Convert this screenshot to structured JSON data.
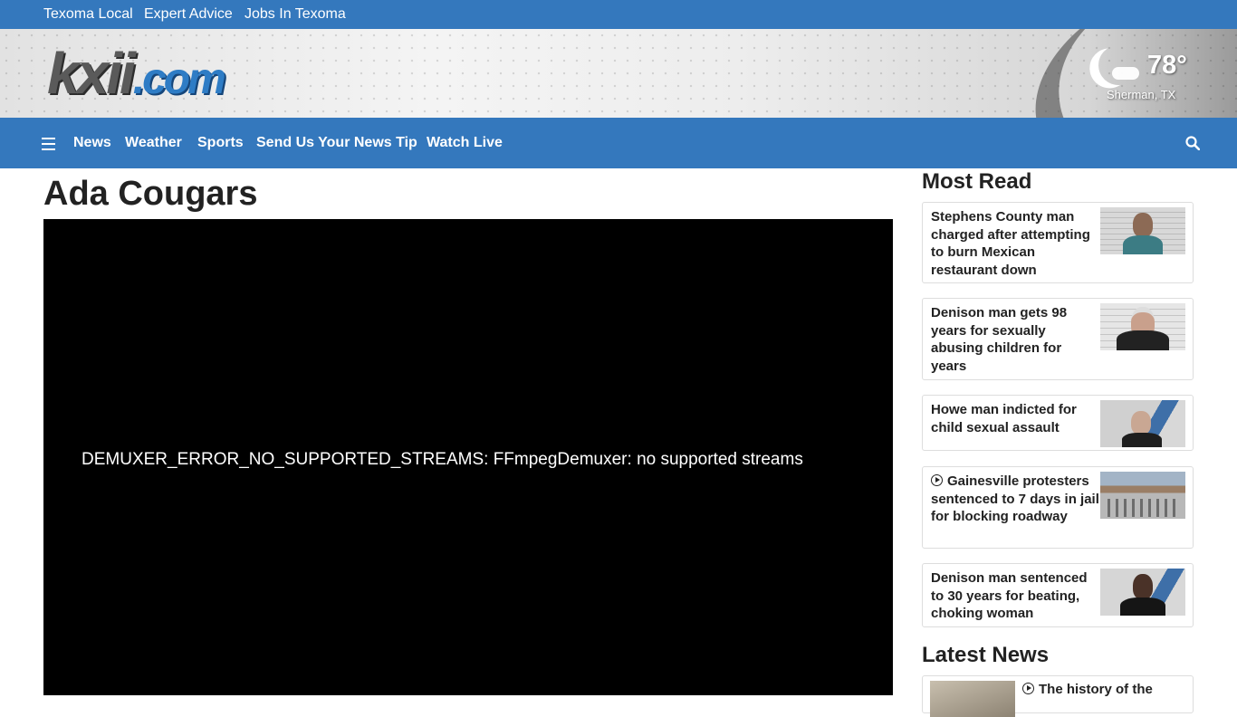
{
  "topbar": {
    "links": [
      "Texoma Local",
      "Expert Advice",
      "Jobs In Texoma"
    ]
  },
  "logo": {
    "part1": "kxii",
    "part2": ".com"
  },
  "weather": {
    "temp": "78°",
    "city": "Sherman, TX",
    "icon": "moon-cloud-icon"
  },
  "nav": {
    "items": [
      "News",
      "Weather",
      "Sports",
      "Send Us Your News Tip",
      "Watch Live"
    ]
  },
  "article": {
    "title": "Ada Cougars",
    "video_error": "DEMUXER_ERROR_NO_SUPPORTED_STREAMS: FFmpegDemuxer: no supported streams"
  },
  "most_read": {
    "heading": "Most Read",
    "items": [
      "Stephens County man charged after attempting to burn Mexican restaurant down",
      "Denison man gets 98 years for sexually abusing children for years",
      "Howe man indicted for child sexual assault",
      "Gainesville protesters sentenced to 7 days in jail for blocking roadway",
      "Denison man sentenced to 30 years for beating, choking woman"
    ]
  },
  "latest_news": {
    "heading": "Latest News",
    "items": [
      "The history of the"
    ]
  },
  "colors": {
    "brand_blue": "#3478bd"
  }
}
